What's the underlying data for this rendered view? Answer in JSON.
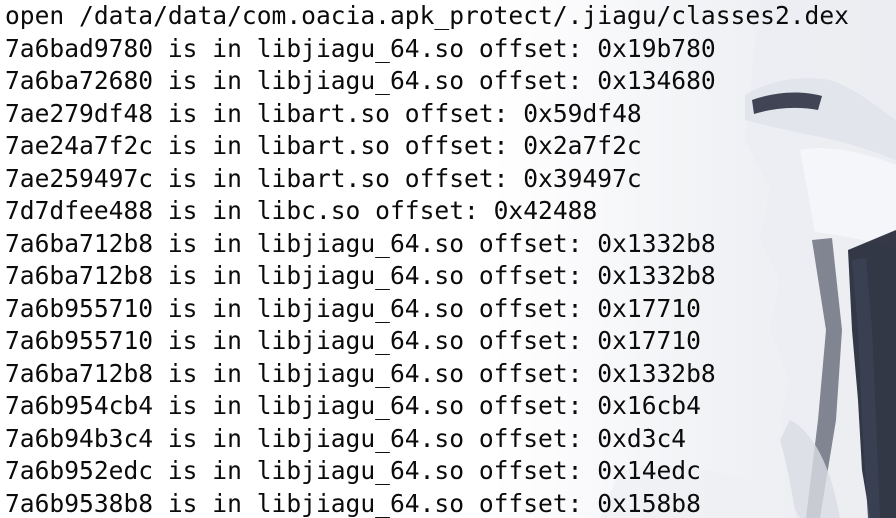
{
  "terminal": {
    "lines": [
      "open /data/data/com.oacia.apk_protect/.jiagu/classes2.dex",
      "7a6bad9780 is in libjiagu_64.so offset: 0x19b780",
      "7a6ba72680 is in libjiagu_64.so offset: 0x134680",
      "7ae279df48 is in libart.so offset: 0x59df48",
      "7ae24a7f2c is in libart.so offset: 0x2a7f2c",
      "7ae259497c is in libart.so offset: 0x39497c",
      "7d7dfee488 is in libc.so offset: 0x42488",
      "7a6ba712b8 is in libjiagu_64.so offset: 0x1332b8",
      "7a6ba712b8 is in libjiagu_64.so offset: 0x1332b8",
      "7a6b955710 is in libjiagu_64.so offset: 0x17710",
      "7a6b955710 is in libjiagu_64.so offset: 0x17710",
      "7a6ba712b8 is in libjiagu_64.so offset: 0x1332b8",
      "7a6b954cb4 is in libjiagu_64.so offset: 0x16cb4",
      "7a6b94b3c4 is in libjiagu_64.so offset: 0xd3c4",
      "7a6b952edc is in libjiagu_64.so offset: 0x14edc",
      "7a6b9538b8 is in libjiagu_64.so offset: 0x158b8"
    ]
  },
  "colors": {
    "text": "#0b0b0b",
    "background": "#ffffff",
    "art_dark": "#1f2433",
    "art_light": "#e6e8ee"
  },
  "icons": {
    "background": "anime-character-wallpaper-icon"
  }
}
